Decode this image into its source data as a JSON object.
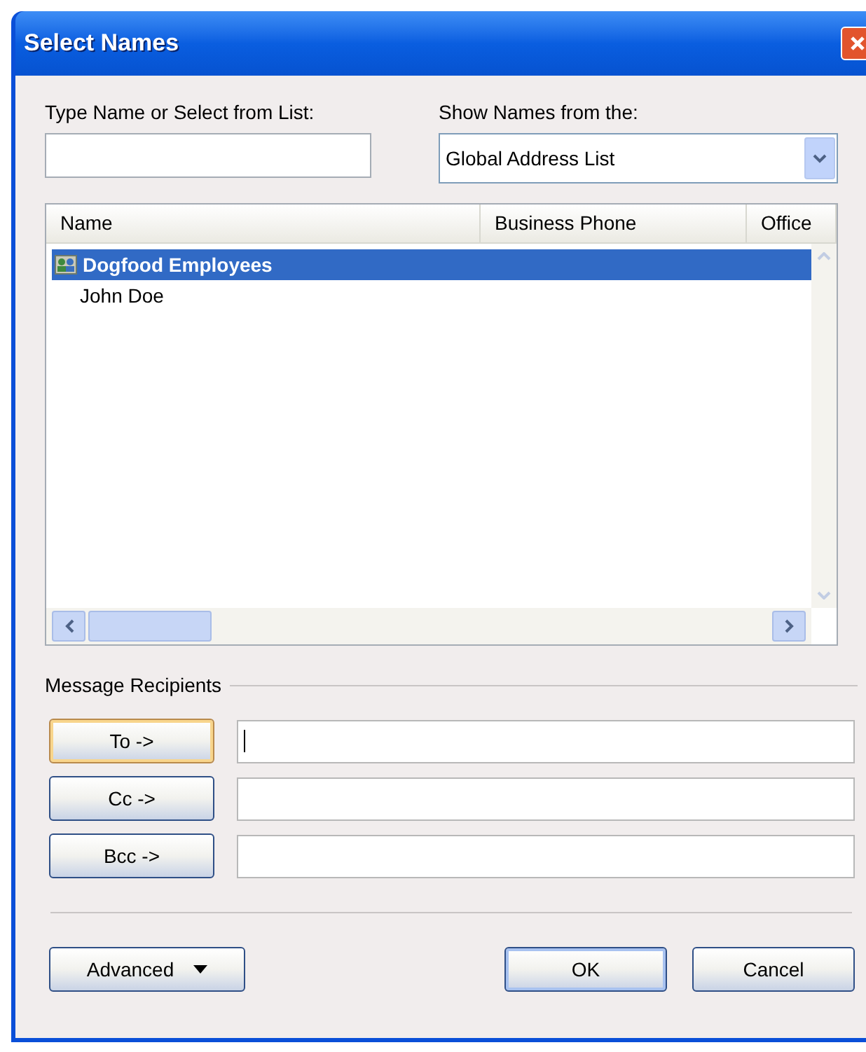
{
  "window": {
    "title": "Select Names"
  },
  "search": {
    "label": "Type Name or Select from List:"
  },
  "address_book": {
    "label": "Show Names from the:",
    "value": "Global Address List"
  },
  "table": {
    "columns": [
      "Name",
      "Business Phone",
      "Office"
    ],
    "rows": [
      {
        "kind": "group",
        "name": "Dogfood Employees",
        "selected": true
      },
      {
        "kind": "contact",
        "name": "John Doe",
        "selected": false
      }
    ]
  },
  "recipients": {
    "label": "Message Recipients",
    "fields": [
      {
        "button": "To ->",
        "focused": true
      },
      {
        "button": "Cc ->",
        "focused": false
      },
      {
        "button": "Bcc ->",
        "focused": false
      }
    ]
  },
  "buttons": {
    "advanced": "Advanced",
    "ok": "OK",
    "cancel": "Cancel"
  }
}
